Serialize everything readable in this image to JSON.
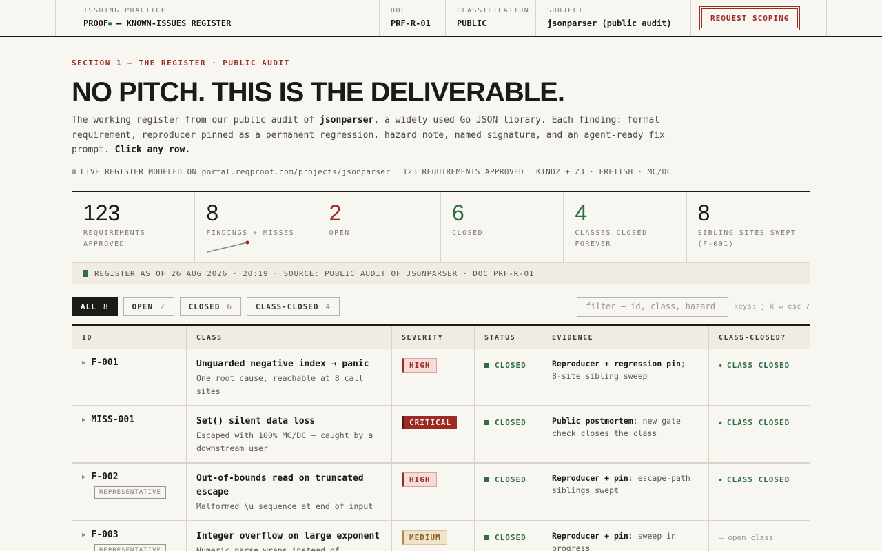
{
  "header": {
    "practice_label": "ISSUING PRACTICE",
    "practice_name": "PROOF",
    "practice_suffix": " — KNOWN-ISSUES REGISTER",
    "doc_label": "DOC",
    "doc_value": "PRF-R-01",
    "classification_label": "CLASSIFICATION",
    "classification_value": "PUBLIC",
    "subject_label": "SUBJECT",
    "subject_value": "jsonparser (public audit)",
    "cta_label": "REQUEST SCOPING"
  },
  "hero": {
    "kicker": "SECTION 1 — THE REGISTER · PUBLIC AUDIT",
    "headline": "NO PITCH. THIS IS THE DELIVERABLE.",
    "lede_1": "The working register from our public audit of ",
    "lede_bold": "jsonparser",
    "lede_2": ", a widely used Go JSON library. Each finding: formal requirement, reproducer pinned as a permanent regression, hazard note, named signature, and an agent-ready fix prompt. ",
    "lede_cta": "Click any row.",
    "meta_live": "LIVE REGISTER MODELED ON portal.reqproof.com/projects/jsonparser",
    "meta_reqs": "123 REQUIREMENTS APPROVED",
    "meta_tools": "KIND2 + Z3 · FRETISH · MC/DC"
  },
  "stats": [
    {
      "value": "123",
      "label": "REQUIREMENTS APPROVED",
      "tone": "dark"
    },
    {
      "value": "8",
      "label": "FINDINGS + MISSES",
      "tone": "dark"
    },
    {
      "value": "2",
      "label": "OPEN",
      "tone": "red"
    },
    {
      "value": "6",
      "label": "CLOSED",
      "tone": "green"
    },
    {
      "value": "4",
      "label": "CLASSES CLOSED FOREVER",
      "tone": "green"
    },
    {
      "value": "8",
      "label": "SIBLING SITES SWEPT (F-001)",
      "tone": "dark"
    }
  ],
  "stats_footer": "REGISTER AS OF 26 AUG 2026 · 20:19 · SOURCE: PUBLIC AUDIT OF JSONPARSER · DOC PRF-R-01",
  "filters": {
    "chips": [
      {
        "label": "ALL",
        "count": "8"
      },
      {
        "label": "OPEN",
        "count": "2"
      },
      {
        "label": "CLOSED",
        "count": "6"
      },
      {
        "label": "CLASS-CLOSED",
        "count": "4"
      }
    ],
    "search_placeholder": "filter — id, class, hazard",
    "keys_hint": "keys: j k ↵ esc /"
  },
  "table": {
    "columns": [
      "ID",
      "CLASS",
      "SEVERITY",
      "STATUS",
      "EVIDENCE",
      "CLASS-CLOSED?"
    ],
    "rows": [
      {
        "id": "F-001",
        "badge": "",
        "title": "Unguarded negative index → panic",
        "subtitle": "One root cause, reachable at 8 call sites",
        "severity": "HIGH",
        "status": "CLOSED",
        "evidence_bold": "Reproducer + regression pin",
        "evidence_rest": "; 8-site sibling sweep",
        "class_closed": "CLASS CLOSED"
      },
      {
        "id": "MISS-001",
        "badge": "",
        "title": "Set() silent data loss",
        "subtitle": "Escaped with 100% MC/DC — caught by a downstream user",
        "severity": "CRITICAL",
        "status": "CLOSED",
        "evidence_bold": "Public postmortem",
        "evidence_rest": "; new gate check closes the class",
        "class_closed": "CLASS CLOSED"
      },
      {
        "id": "F-002",
        "badge": "REPRESENTATIVE",
        "title": "Out-of-bounds read on truncated escape",
        "subtitle": "Malformed \\u sequence at end of input",
        "severity": "HIGH",
        "status": "CLOSED",
        "evidence_bold": "Reproducer + pin",
        "evidence_rest": "; escape-path siblings swept",
        "class_closed": "CLASS CLOSED"
      },
      {
        "id": "F-003",
        "badge": "REPRESENTATIVE",
        "title": "Integer overflow on large exponent",
        "subtitle": "Numeric parse wraps instead of erroring",
        "severity": "MEDIUM",
        "status": "CLOSED",
        "evidence_bold": "Reproducer + pin",
        "evidence_rest": "; sweep in progress",
        "class_closed": "— open class"
      }
    ]
  }
}
